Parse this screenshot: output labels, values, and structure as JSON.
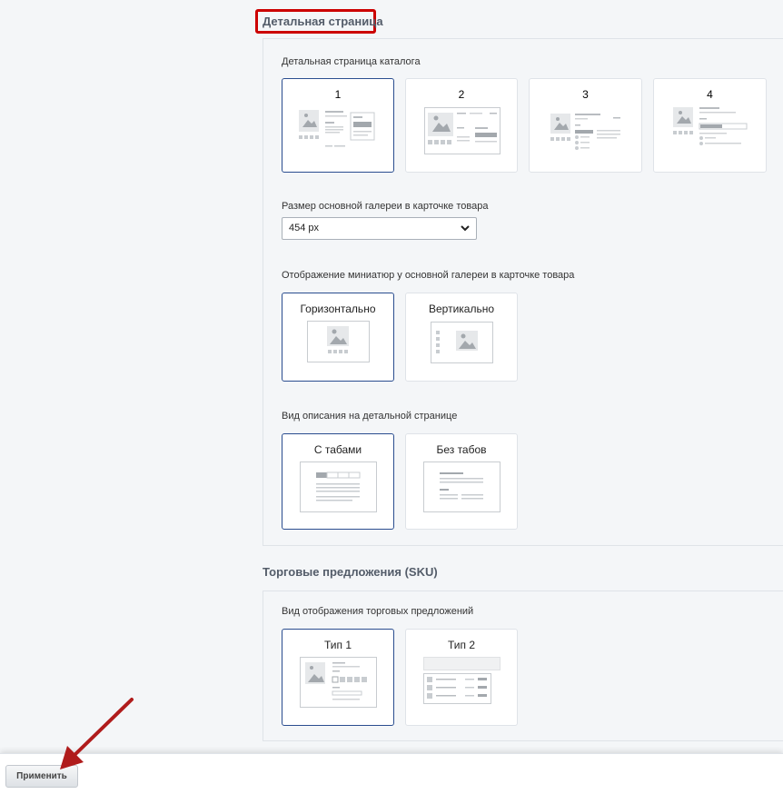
{
  "detail": {
    "title": "Детальная страница",
    "catalog_label": "Детальная страница каталога",
    "catalog_options": [
      {
        "label": "1",
        "selected": true
      },
      {
        "label": "2",
        "selected": false
      },
      {
        "label": "3",
        "selected": false
      },
      {
        "label": "4",
        "selected": false
      }
    ],
    "gallery_size_label": "Размер основной галереи в карточке товара",
    "gallery_size_value": "454 px",
    "thumbs_label": "Отображение миниатюр у основной галереи в карточке товара",
    "thumbs_options": [
      {
        "label": "Горизонтально",
        "selected": true
      },
      {
        "label": "Вертикально",
        "selected": false
      }
    ],
    "desc_label": "Вид описания на детальной странице",
    "desc_options": [
      {
        "label": "С табами",
        "selected": true
      },
      {
        "label": "Без табов",
        "selected": false
      }
    ]
  },
  "sku": {
    "title": "Торговые предложения (SKU)",
    "view_label": "Вид отображения торговых предложений",
    "options": [
      {
        "label": "Тип 1",
        "selected": true
      },
      {
        "label": "Тип 2",
        "selected": false
      }
    ]
  },
  "footer": {
    "apply_label": "Применить"
  },
  "colors": {
    "selected_border": "#2a4d8f",
    "highlight": "#cc0000",
    "arrow": "#b01c1c"
  }
}
